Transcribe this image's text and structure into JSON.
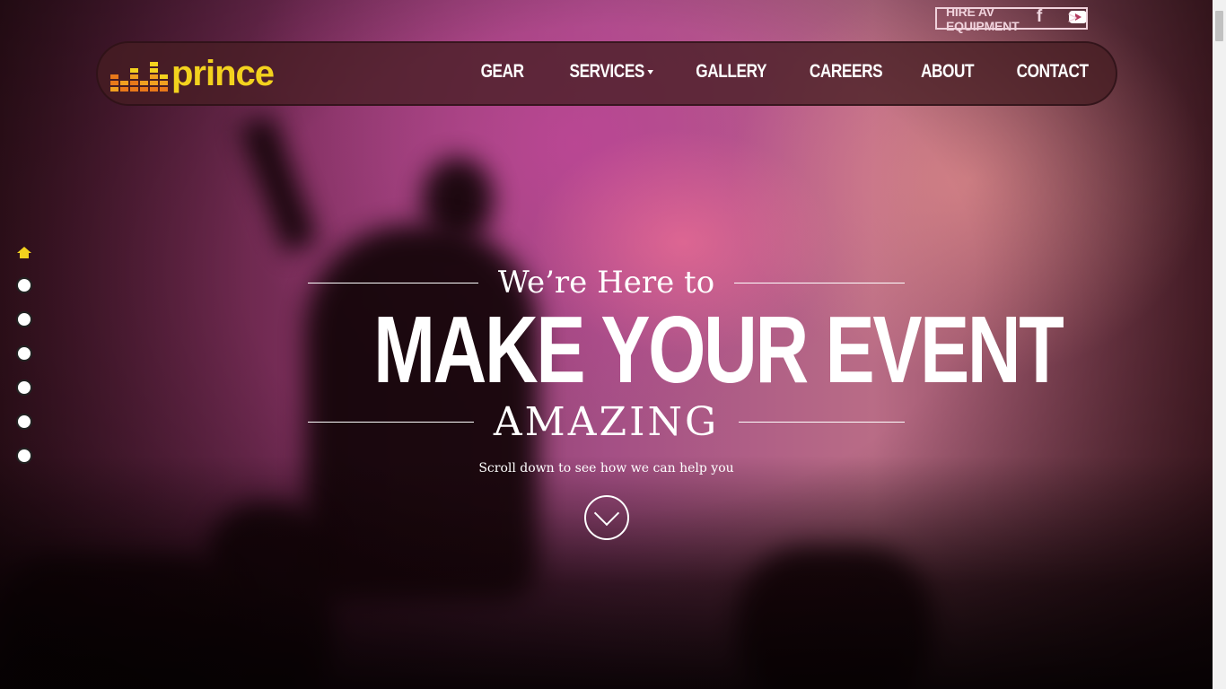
{
  "topbar": {
    "facebook_icon": "facebook-icon",
    "youtube_icon": "youtube-icon",
    "hire_label": "HIRE AV EQUIPMENT",
    "hire_arrow": ">"
  },
  "logo": {
    "text": "prince"
  },
  "nav": {
    "items": [
      {
        "label": "GEAR"
      },
      {
        "label": "SERVICES"
      },
      {
        "label": "GALLERY"
      },
      {
        "label": "CAREERS"
      },
      {
        "label": "ABOUT"
      },
      {
        "label": "CONTACT"
      }
    ]
  },
  "hero": {
    "pre_heading": "We’re Here to",
    "heading": "MAKE YOUR EVENT",
    "emphasis": "AMAZING",
    "subtext": "Scroll down to see how we can help you"
  },
  "colors": {
    "accent": "#f3d21e",
    "logo_orange": "#e8781a",
    "text": "#ffffff"
  }
}
